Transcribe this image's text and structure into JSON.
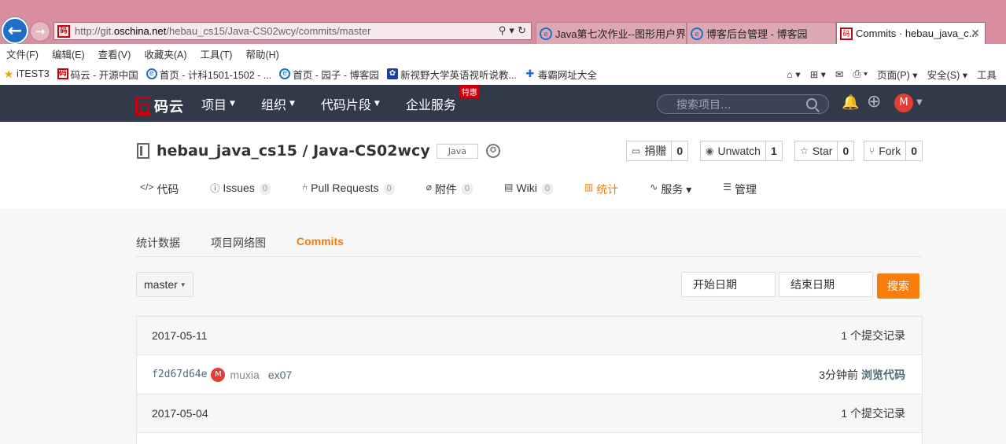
{
  "browser": {
    "url_prefix": "http://git.",
    "url_host": "oschina.net",
    "url_path": "/hebau_cs15/Java-CS02wcy/commits/master",
    "search_ctl": "⚲ ▾ ↻",
    "tabs": [
      {
        "label": "Java第七次作业--图形用户界...",
        "icon": "ie-icon"
      },
      {
        "label": "博客后台管理 - 博客园",
        "icon": "ie-icon"
      },
      {
        "label": "Commits · hebau_java_c...",
        "icon": "gitee-icon"
      }
    ],
    "menu": [
      "文件(F)",
      "编辑(E)",
      "查看(V)",
      "收藏夹(A)",
      "工具(T)",
      "帮助(H)"
    ],
    "favorites": [
      {
        "label": "iTEST3",
        "icon": "star"
      },
      {
        "label": "码云 - 开源中国",
        "icon": "red"
      },
      {
        "label": "首页 - 计科1501-1502 - ...",
        "icon": "blue"
      },
      {
        "label": "首页 - 园子 - 博客园",
        "icon": "blue"
      },
      {
        "label": "新视野大学英语视听说教...",
        "icon": "paw"
      },
      {
        "label": "毒霸网址大全",
        "icon": "bolt"
      }
    ],
    "favbar_right": [
      "⌂ ▾",
      "⊞ ▾",
      "✉",
      "⎙ ▾",
      "页面(P) ▾",
      "安全(S) ▾",
      "工具"
    ]
  },
  "site": {
    "logo_text": "码云",
    "nav": [
      {
        "label": "项目",
        "caret": true
      },
      {
        "label": "组织",
        "caret": true
      },
      {
        "label": "代码片段",
        "caret": true
      },
      {
        "label": "企业服务",
        "caret": false,
        "badge": "特惠"
      }
    ],
    "search_placeholder": "搜索项目...",
    "avatar_initial": "M"
  },
  "repo": {
    "owner": "hebau_java_cs15",
    "sep": " / ",
    "name": "Java-CS02wcy",
    "lang": "Java",
    "actions": [
      {
        "icon": "▭",
        "label": "捐赠",
        "count": "0"
      },
      {
        "icon": "◉",
        "label": "Unwatch",
        "count": "1"
      },
      {
        "icon": "☆",
        "label": "Star",
        "count": "0"
      },
      {
        "icon": "⑂",
        "label": "Fork",
        "count": "0"
      }
    ],
    "tabs": [
      {
        "icon": "</>",
        "label": "代码"
      },
      {
        "icon": "ⓘ",
        "label": "Issues",
        "count": "0"
      },
      {
        "icon": "⑃",
        "label": "Pull Requests",
        "count": "0"
      },
      {
        "icon": "⌀",
        "label": "附件",
        "count": "0"
      },
      {
        "icon": "▤",
        "label": "Wiki",
        "count": "0"
      },
      {
        "icon": "▥",
        "label": "统计",
        "active": true
      },
      {
        "icon": "∿",
        "label": "服务 ▾"
      },
      {
        "icon": "☰",
        "label": "管理"
      }
    ]
  },
  "stats": {
    "subnav": [
      "统计数据",
      "项目网络图",
      "Commits"
    ],
    "branch": "master",
    "start_date": "开始日期",
    "end_date": "结束日期",
    "search_btn": "搜索"
  },
  "commits": [
    {
      "date": "2017-05-11",
      "summary": "1 个提交记录",
      "items": [
        {
          "sha": "f2d67d64e",
          "avatar": "M",
          "author": "muxia",
          "message": "ex07",
          "time": "3分钟前",
          "browse": "浏览代码"
        }
      ]
    },
    {
      "date": "2017-05-04",
      "summary": "1 个提交记录",
      "items": []
    }
  ]
}
